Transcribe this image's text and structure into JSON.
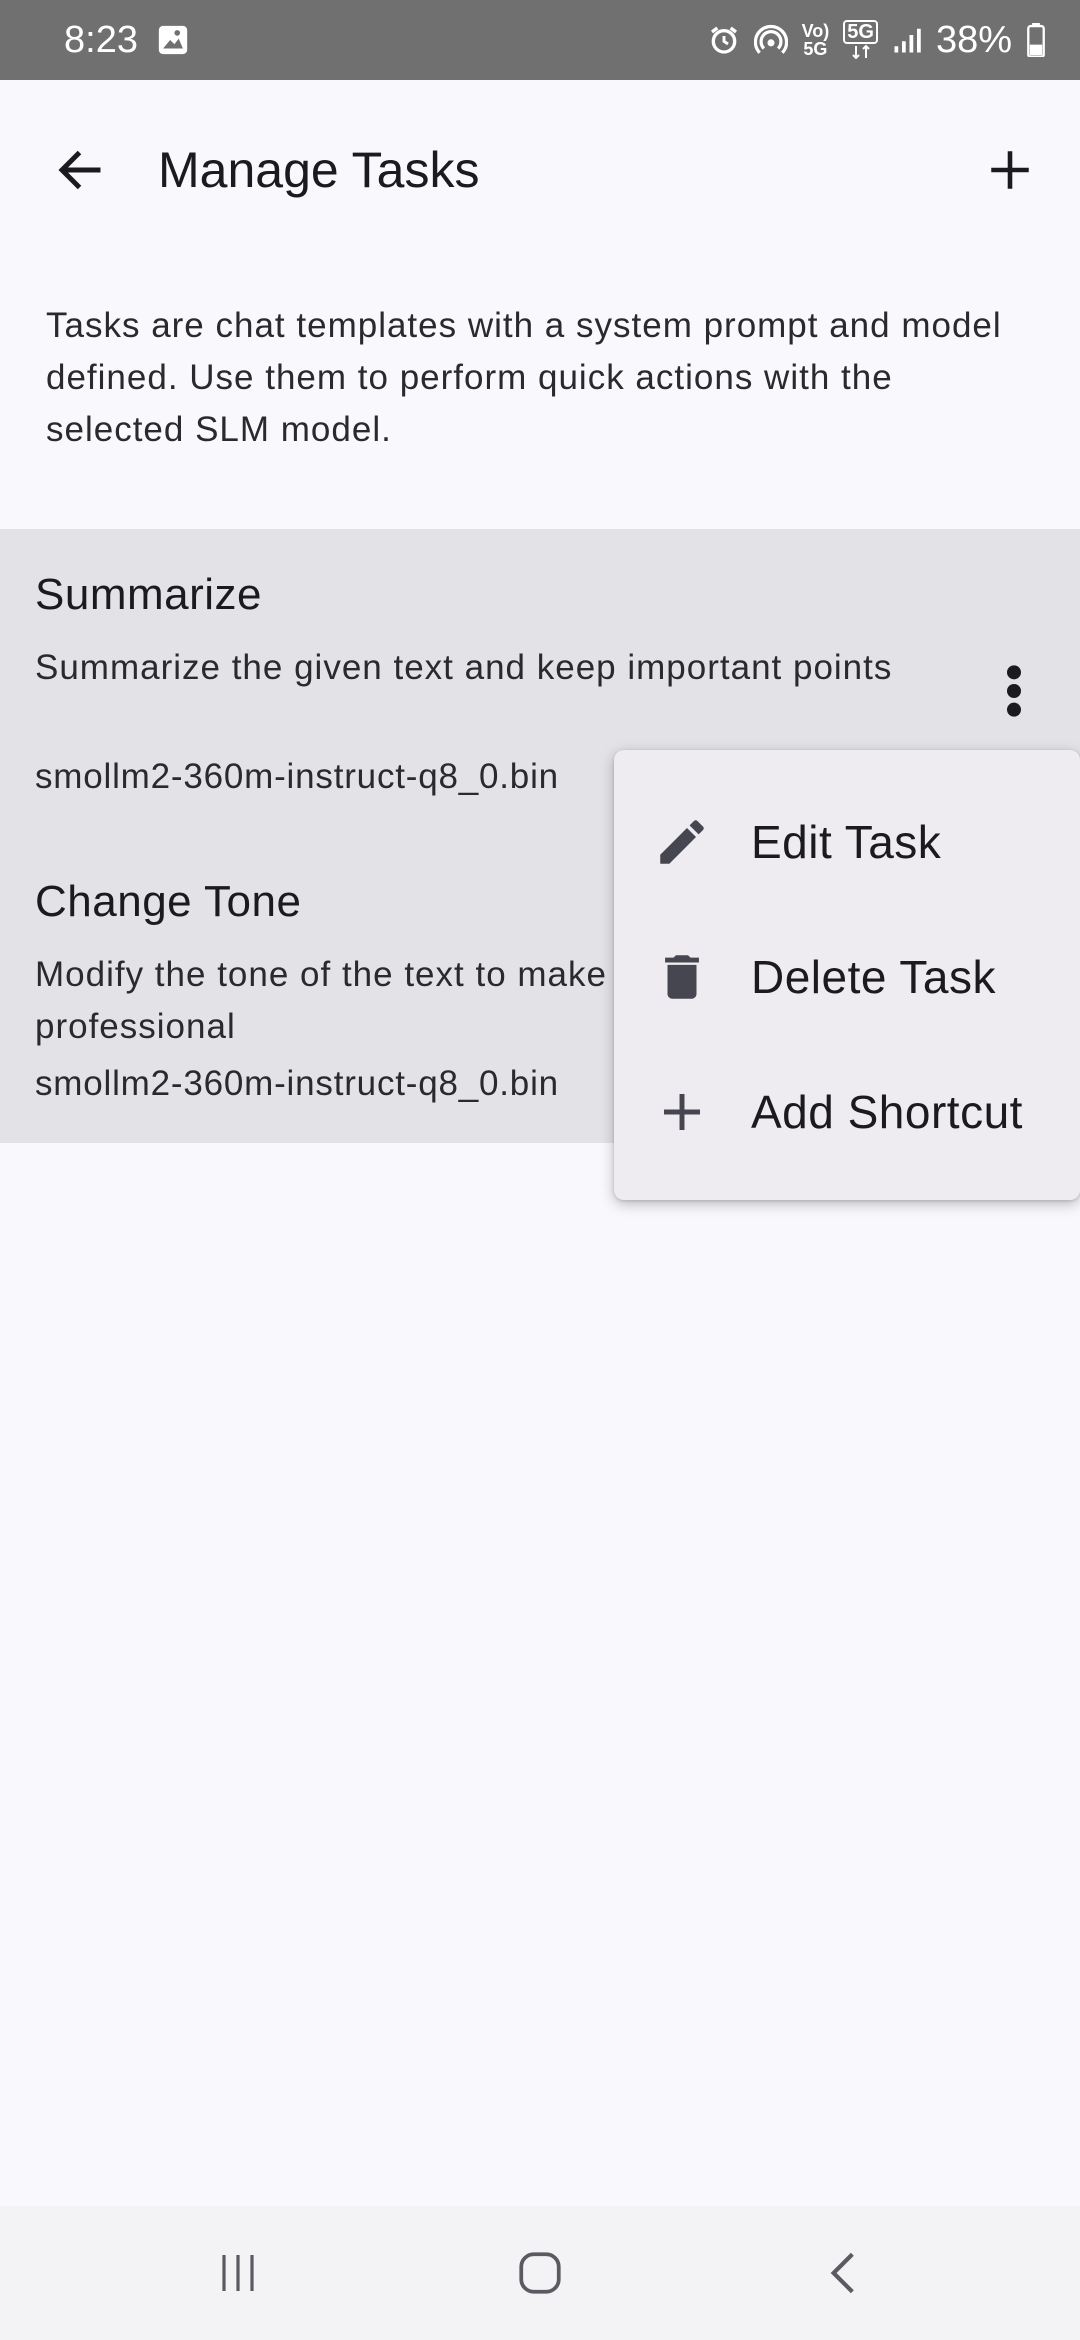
{
  "status_bar": {
    "time": "8:23",
    "volte_label": "Vo)\n5G",
    "network_label": "5G",
    "battery_percent": "38%",
    "icons": [
      "gallery-icon",
      "alarm-icon",
      "hotspot-icon",
      "volte-icon",
      "5g-data-icon",
      "signal-icon",
      "battery-icon"
    ]
  },
  "app_bar": {
    "title": "Manage Tasks",
    "back_icon": "arrow-back-icon",
    "add_icon": "plus-icon"
  },
  "description": "Tasks are chat templates with a system prompt and model defined. Use them to perform quick actions with the selected SLM model.",
  "tasks": [
    {
      "name": "Summarize",
      "description": "Summarize the given text and keep important points",
      "model": "smollm2-360m-instruct-q8_0.bin"
    },
    {
      "name": "Change Tone",
      "description": "Modify the tone of the text to make it more professional",
      "model": "smollm2-360m-instruct-q8_0.bin"
    }
  ],
  "context_menu": {
    "items": [
      {
        "label": "Edit Task",
        "icon": "pencil-icon"
      },
      {
        "label": "Delete Task",
        "icon": "trash-icon"
      },
      {
        "label": "Add Shortcut",
        "icon": "plus-icon"
      }
    ]
  },
  "nav_bar": {
    "icons": [
      "recent-apps-icon",
      "home-icon",
      "back-icon"
    ]
  },
  "colors": {
    "status_bar_bg": "#707070",
    "background": "#f9f9fd",
    "list_bg": "#e3e3e7",
    "menu_bg": "#eeecf1",
    "icon_dark": "#45464f"
  }
}
